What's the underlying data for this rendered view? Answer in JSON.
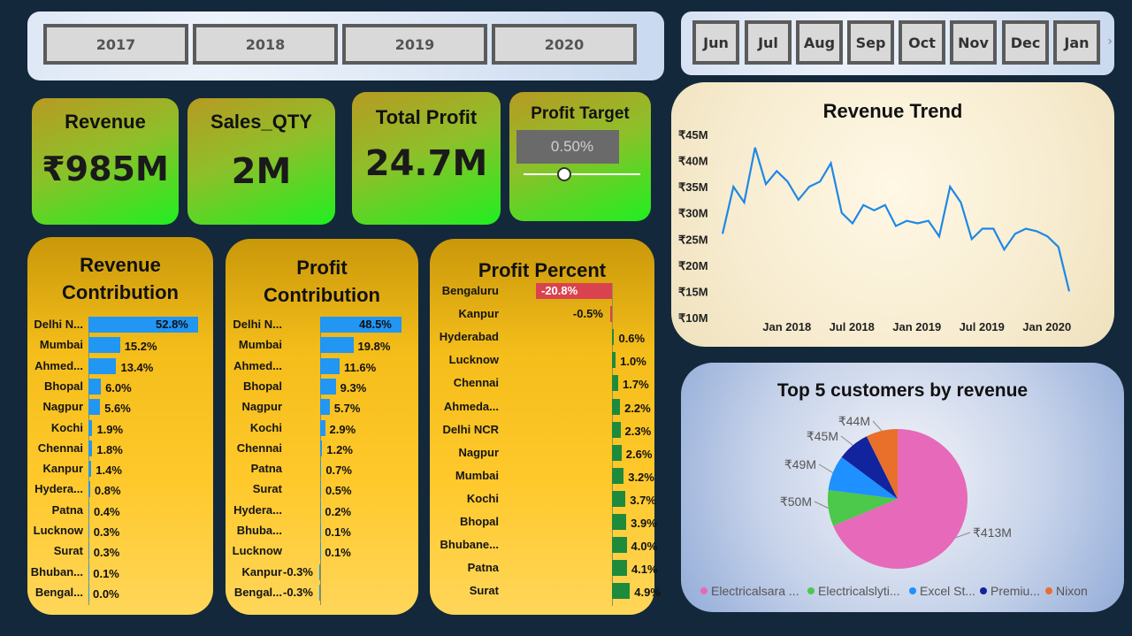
{
  "years": [
    "2017",
    "2018",
    "2019",
    "2020"
  ],
  "months": [
    "Jun",
    "Jul",
    "Aug",
    "Sep",
    "Oct",
    "Nov",
    "Dec",
    "Jan"
  ],
  "month_scroll_icon": "chevron-right-icon",
  "kpis": {
    "revenue": {
      "title": "Revenue",
      "value": "₹985M"
    },
    "sales_qty": {
      "title": "Sales_QTY",
      "value": "2M"
    },
    "total_profit": {
      "title": "Total Profit",
      "value": "24.7M"
    },
    "profit_target": {
      "title": "Profit Target",
      "input_value": "0.50%",
      "slider_fraction": 0.35
    }
  },
  "revenue_contribution": {
    "title_line1": "Revenue",
    "title_line2": "Contribution",
    "rows": [
      {
        "label": "Delhi N...",
        "value": 52.8,
        "text": "52.8%"
      },
      {
        "label": "Mumbai",
        "value": 15.2,
        "text": "15.2%"
      },
      {
        "label": "Ahmed...",
        "value": 13.4,
        "text": "13.4%"
      },
      {
        "label": "Bhopal",
        "value": 6.0,
        "text": "6.0%"
      },
      {
        "label": "Nagpur",
        "value": 5.6,
        "text": "5.6%"
      },
      {
        "label": "Kochi",
        "value": 1.9,
        "text": "1.9%"
      },
      {
        "label": "Chennai",
        "value": 1.8,
        "text": "1.8%"
      },
      {
        "label": "Kanpur",
        "value": 1.4,
        "text": "1.4%"
      },
      {
        "label": "Hydera...",
        "value": 0.8,
        "text": "0.8%"
      },
      {
        "label": "Patna",
        "value": 0.4,
        "text": "0.4%"
      },
      {
        "label": "Lucknow",
        "value": 0.3,
        "text": "0.3%"
      },
      {
        "label": "Surat",
        "value": 0.3,
        "text": "0.3%"
      },
      {
        "label": "Bhuban...",
        "value": 0.1,
        "text": "0.1%"
      },
      {
        "label": "Bengal...",
        "value": 0.0,
        "text": "0.0%"
      }
    ]
  },
  "profit_contribution": {
    "title_line1": "Profit",
    "title_line2": "Contribution",
    "rows": [
      {
        "label": "Delhi N...",
        "value": 48.5,
        "text": "48.5%"
      },
      {
        "label": "Mumbai",
        "value": 19.8,
        "text": "19.8%"
      },
      {
        "label": "Ahmed...",
        "value": 11.6,
        "text": "11.6%"
      },
      {
        "label": "Bhopal",
        "value": 9.3,
        "text": "9.3%"
      },
      {
        "label": "Nagpur",
        "value": 5.7,
        "text": "5.7%"
      },
      {
        "label": "Kochi",
        "value": 2.9,
        "text": "2.9%"
      },
      {
        "label": "Chennai",
        "value": 1.2,
        "text": "1.2%"
      },
      {
        "label": "Patna",
        "value": 0.7,
        "text": "0.7%"
      },
      {
        "label": "Surat",
        "value": 0.5,
        "text": "0.5%"
      },
      {
        "label": "Hydera...",
        "value": 0.2,
        "text": "0.2%"
      },
      {
        "label": "Bhuba...",
        "value": 0.1,
        "text": "0.1%"
      },
      {
        "label": "Lucknow",
        "value": 0.1,
        "text": "0.1%"
      },
      {
        "label": "Kanpur",
        "value": -0.3,
        "text": "-0.3%"
      },
      {
        "label": "Bengal...",
        "value": -0.3,
        "text": "-0.3%"
      }
    ]
  },
  "profit_percent": {
    "title": "Profit Percent",
    "rows": [
      {
        "label": "Bengaluru",
        "value": -20.8,
        "text": "-20.8%"
      },
      {
        "label": "Kanpur",
        "value": -0.5,
        "text": "-0.5%"
      },
      {
        "label": "Hyderabad",
        "value": 0.6,
        "text": "0.6%"
      },
      {
        "label": "Lucknow",
        "value": 1.0,
        "text": "1.0%"
      },
      {
        "label": "Chennai",
        "value": 1.7,
        "text": "1.7%"
      },
      {
        "label": "Ahmeda...",
        "value": 2.2,
        "text": "2.2%"
      },
      {
        "label": "Delhi NCR",
        "value": 2.3,
        "text": "2.3%"
      },
      {
        "label": "Nagpur",
        "value": 2.6,
        "text": "2.6%"
      },
      {
        "label": "Mumbai",
        "value": 3.2,
        "text": "3.2%"
      },
      {
        "label": "Kochi",
        "value": 3.7,
        "text": "3.7%"
      },
      {
        "label": "Bhopal",
        "value": 3.9,
        "text": "3.9%"
      },
      {
        "label": "Bhubane...",
        "value": 4.0,
        "text": "4.0%"
      },
      {
        "label": "Patna",
        "value": 4.1,
        "text": "4.1%"
      },
      {
        "label": "Surat",
        "value": 4.9,
        "text": "4.9%"
      }
    ]
  },
  "colors": {
    "bar_blue": "#2196f3",
    "neg_red": "#d9434f",
    "pos_green": "#1e8a3c",
    "line_blue": "#1e88e5"
  },
  "chart_data": [
    {
      "type": "line",
      "title": "Revenue Trend",
      "x": [
        "2017-10",
        "2017-11",
        "2017-12",
        "2018-01",
        "2018-02",
        "2018-03",
        "2018-04",
        "2018-05",
        "2018-06",
        "2018-07",
        "2018-08",
        "2018-09",
        "2018-10",
        "2018-11",
        "2018-12",
        "2019-01",
        "2019-02",
        "2019-03",
        "2019-04",
        "2019-05",
        "2019-06",
        "2019-07",
        "2019-08",
        "2019-09",
        "2019-10",
        "2019-11",
        "2019-12",
        "2020-01",
        "2020-02",
        "2020-03",
        "2020-04",
        "2020-05",
        "2020-06"
      ],
      "y": [
        26,
        35,
        32,
        42.5,
        35.5,
        38,
        36,
        32.5,
        35,
        36,
        39.5,
        30,
        28,
        31.5,
        30.5,
        31.5,
        27.5,
        28.5,
        28,
        28.5,
        25.5,
        35,
        32,
        25,
        27,
        27,
        23,
        26,
        27,
        26.5,
        25.5,
        23.5,
        15
      ],
      "x_tick_labels": [
        "Jan 2018",
        "Jul 2018",
        "Jan 2019",
        "Jul 2019",
        "Jan 2020"
      ],
      "x_tick_dates": [
        "2018-01",
        "2018-07",
        "2019-01",
        "2019-07",
        "2020-01"
      ],
      "y_tick_labels": [
        "₹10M",
        "₹15M",
        "₹20M",
        "₹25M",
        "₹30M",
        "₹35M",
        "₹40M",
        "₹45M"
      ],
      "y_ticks": [
        10,
        15,
        20,
        25,
        30,
        35,
        40,
        45
      ],
      "ylim": [
        10,
        45
      ],
      "xlabel": "",
      "ylabel": "",
      "grid": false
    },
    {
      "type": "pie",
      "title": "Top 5 customers by revenue",
      "slices": [
        {
          "legend": "Electricalsara ...",
          "value": 413,
          "label": "₹413M",
          "color": "#e769b9"
        },
        {
          "legend": "Electricalslyti...",
          "value": 50,
          "label": "₹50M",
          "color": "#4cc84a"
        },
        {
          "legend": "Excel St...",
          "value": 49,
          "label": "₹49M",
          "color": "#1e90ff"
        },
        {
          "legend": "Premiu...",
          "value": 45,
          "label": "₹45M",
          "color": "#12239e"
        },
        {
          "legend": "Nixon",
          "value": 44,
          "label": "₹44M",
          "color": "#e8702a"
        }
      ]
    }
  ]
}
